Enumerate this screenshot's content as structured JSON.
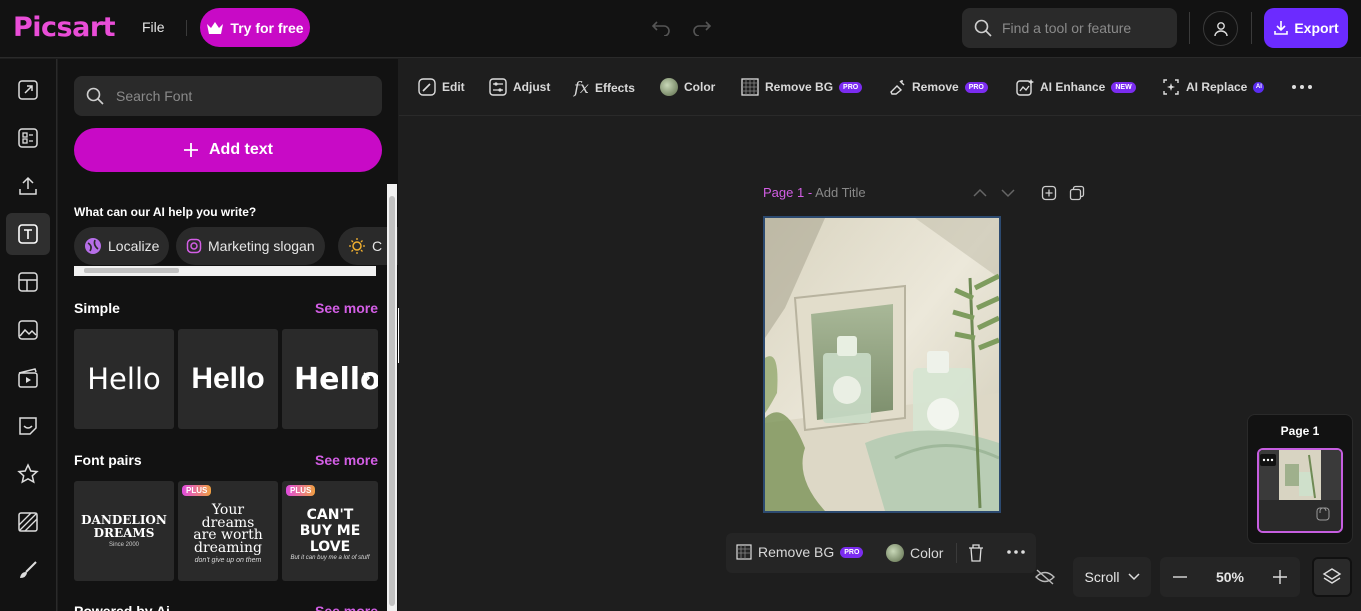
{
  "header": {
    "logo": "Picsart",
    "file_label": "File",
    "try_label": "Try for free",
    "search_placeholder": "Find a tool or feature",
    "export_label": "Export"
  },
  "rail": {
    "items": [
      "resize-icon",
      "templates-icon",
      "upload-icon",
      "text-icon",
      "layouts-icon",
      "photos-icon",
      "video-icon",
      "stickers-icon",
      "favorites-icon",
      "backgrounds-icon",
      "draw-icon"
    ],
    "active": "text-icon"
  },
  "panel": {
    "search_placeholder": "Search Font",
    "add_text_label": "Add text",
    "ai_question": "What can our AI help you write?",
    "chips": [
      "Localize",
      "Marketing slogan",
      "C"
    ],
    "simple": {
      "title": "Simple",
      "see_more": "See more",
      "tiles": [
        "Hello",
        "Hello",
        "Hello"
      ]
    },
    "font_pairs": {
      "title": "Font pairs",
      "see_more": "See more",
      "tile1_line1": "DANDELION",
      "tile1_line2": "DREAMS",
      "tile1_small": "Since 2000",
      "tile2_badge": "PLUS",
      "tile2_text": "Your dreams are worth dreaming",
      "tile2_script": "don't give up on them",
      "tile3_badge": "PLUS",
      "tile3_text": "CAN'T BUY ME LOVE",
      "tile3_script": "But it can buy me a lot of stuff"
    },
    "powered": {
      "title": "Powered by Ai",
      "see_more": "See more"
    }
  },
  "toolbar": {
    "items": [
      {
        "label": "Edit"
      },
      {
        "label": "Adjust"
      },
      {
        "label": "Effects"
      },
      {
        "label": "Color"
      },
      {
        "label": "Remove BG",
        "badge": "PRO"
      },
      {
        "label": "Remove",
        "badge": "PRO"
      },
      {
        "label": "AI Enhance",
        "badge": "NEW"
      },
      {
        "label": "AI Replace",
        "badge": "AI"
      }
    ]
  },
  "canvas": {
    "page_name": "Page 1 -",
    "title_placeholder": "Add Title"
  },
  "float_bar": {
    "remove_bg": "Remove BG",
    "remove_bg_badge": "PRO",
    "color": "Color"
  },
  "pages_panel": {
    "title": "Page 1"
  },
  "bottom": {
    "scroll_label": "Scroll",
    "zoom": "50%"
  },
  "colors": {
    "accent": "#c80ac6",
    "export": "#6c2bff",
    "pro_badge": "#7b2cf0"
  }
}
